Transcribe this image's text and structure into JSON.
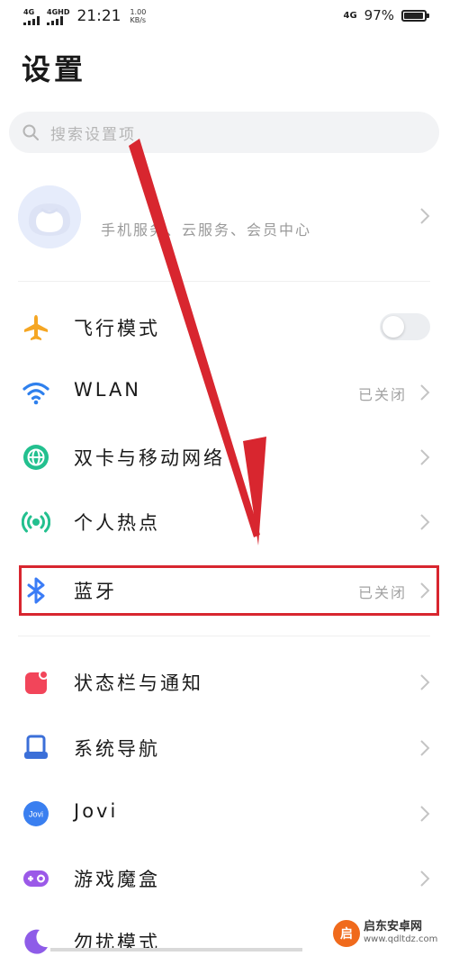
{
  "status_bar": {
    "signal1_label": "4G",
    "signal2_label": "4GHD",
    "time": "21:21",
    "net_speed_value": "1.00",
    "net_speed_unit": "KB/s",
    "network_label": "4G",
    "battery_text": "97%",
    "battery_level": 0.97
  },
  "page": {
    "title": "设置"
  },
  "search": {
    "placeholder": "搜索设置项"
  },
  "account": {
    "text": "手机服务、云服务、会员中心"
  },
  "settings": {
    "airplane": {
      "label": "飞行模式",
      "toggle_on": false
    },
    "wlan": {
      "label": "WLAN",
      "value": "已关闭"
    },
    "dual_sim": {
      "label": "双卡与移动网络"
    },
    "hotspot": {
      "label": "个人热点"
    },
    "bluetooth": {
      "label": "蓝牙",
      "value": "已关闭"
    },
    "statusbar_notifications": {
      "label": "状态栏与通知"
    },
    "system_navigation": {
      "label": "系统导航"
    },
    "jovi": {
      "label": "Jovi",
      "icon_text": "Jovi"
    },
    "game_box": {
      "label": "游戏魔盒"
    },
    "do_not_disturb": {
      "label": "勿扰模式"
    }
  },
  "colors": {
    "airplane": "#f5a623",
    "wlan": "#2f80ed",
    "dual_sim": "#23c08f",
    "hotspot": "#23c08f",
    "bluetooth": "#3b7cf6",
    "statusbar": "#f2455a",
    "navigation": "#3b6fd8",
    "jovi": "#3a7ff0",
    "game_box": "#9b59e8",
    "dnd": "#8e5ce8",
    "annotation": "#d8262f"
  },
  "icons": {
    "airplane": "airplane-icon",
    "wlan": "wifi-icon",
    "dual_sim": "globe-icon",
    "hotspot": "hotspot-icon",
    "bluetooth": "bluetooth-icon",
    "statusbar": "notification-icon",
    "navigation": "navigation-icon",
    "jovi": "jovi-icon",
    "game_box": "gamepad-icon",
    "dnd": "moon-icon"
  },
  "watermark": {
    "logo_text": "启",
    "name": "启东安卓网",
    "url": "www.qdltdz.com"
  }
}
